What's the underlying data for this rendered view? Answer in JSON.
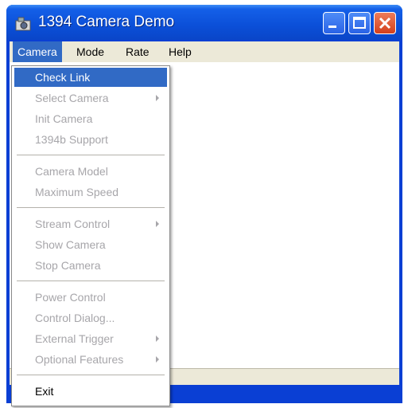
{
  "window": {
    "title": "1394 Camera Demo"
  },
  "menubar": {
    "items": [
      "Camera",
      "Mode",
      "Rate",
      "Help"
    ]
  },
  "camera_menu": {
    "items": [
      {
        "label": "Check Link",
        "state": "highlighted"
      },
      {
        "label": "Select Camera",
        "state": "disabled",
        "submenu": true
      },
      {
        "label": "Init Camera",
        "state": "disabled"
      },
      {
        "label": "1394b Support",
        "state": "disabled"
      },
      {
        "label": "Camera Model",
        "state": "disabled"
      },
      {
        "label": "Maximum Speed",
        "state": "disabled"
      },
      {
        "label": "Stream Control",
        "state": "disabled",
        "submenu": true
      },
      {
        "label": "Show Camera",
        "state": "disabled"
      },
      {
        "label": "Stop Camera",
        "state": "disabled"
      },
      {
        "label": "Power Control",
        "state": "disabled"
      },
      {
        "label": "Control Dialog...",
        "state": "disabled"
      },
      {
        "label": "External Trigger",
        "state": "disabled",
        "submenu": true
      },
      {
        "label": "Optional Features",
        "state": "disabled",
        "submenu": true
      },
      {
        "label": "Exit",
        "state": "enabled"
      }
    ]
  },
  "colors": {
    "titlebar": "#0b4fd8",
    "menu_highlight": "#316ac5",
    "menubar": "#ece9d8",
    "disabled_text": "#a7a6aa"
  }
}
